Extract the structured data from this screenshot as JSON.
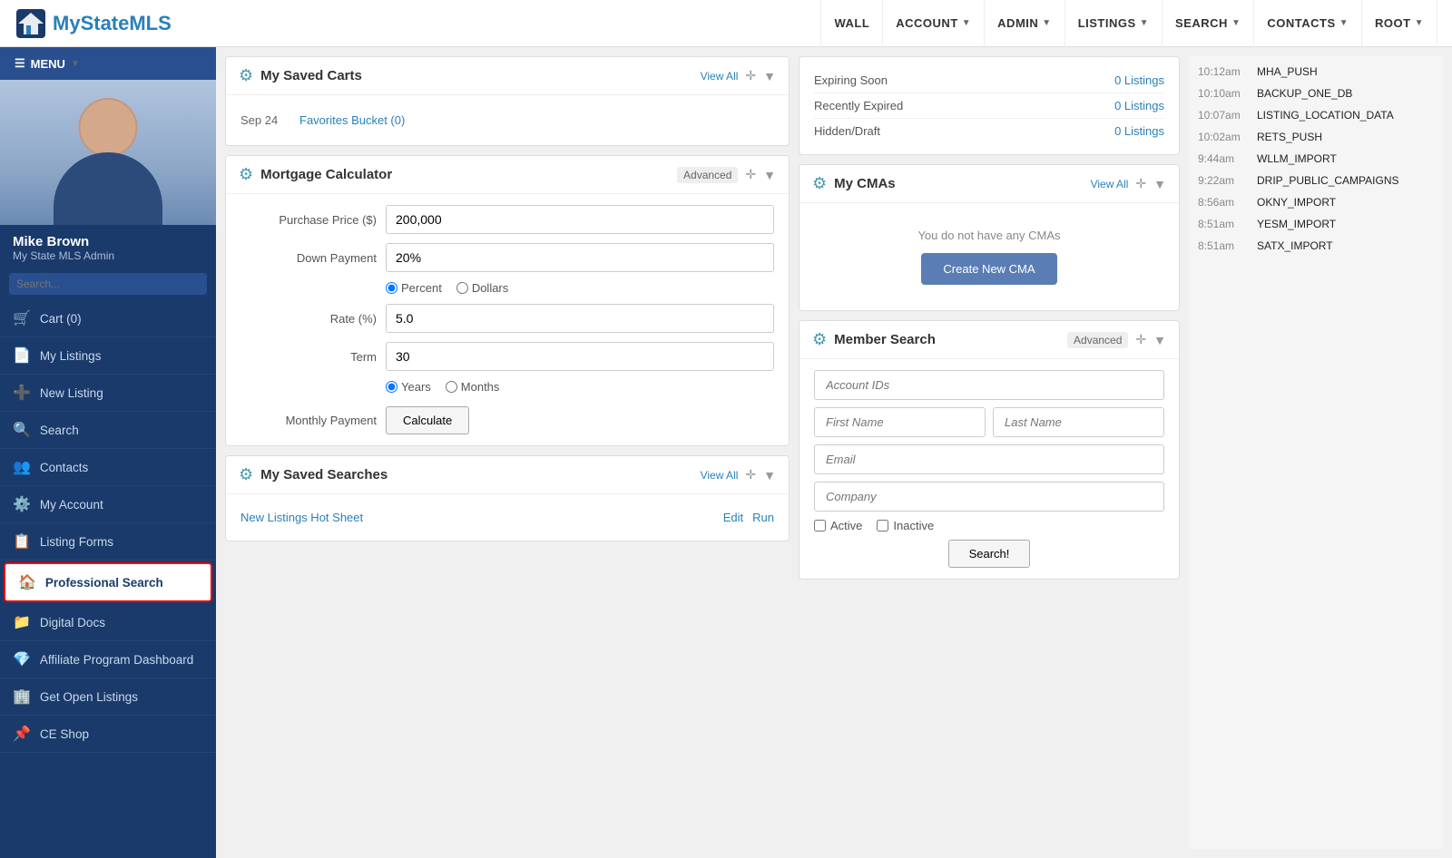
{
  "logo": {
    "text_my": "My",
    "text_state": "State",
    "text_mls": "MLS"
  },
  "topnav": {
    "wall": "WALL",
    "account": "ACCOUNT",
    "admin": "ADMIN",
    "listings": "LISTINGS",
    "search": "SEARCH",
    "contacts": "CONTACTS",
    "root": "ROOT"
  },
  "sidebar": {
    "menu_label": "MENU",
    "user_name": "Mike Brown",
    "user_role": "My State MLS Admin",
    "items": [
      {
        "id": "cart",
        "label": "Cart (0)",
        "icon": "🛒"
      },
      {
        "id": "my-listings",
        "label": "My Listings",
        "icon": "📄"
      },
      {
        "id": "new-listing",
        "label": "New Listing",
        "icon": "➕"
      },
      {
        "id": "search",
        "label": "Search",
        "icon": "🔍"
      },
      {
        "id": "contacts",
        "label": "Contacts",
        "icon": "👥"
      },
      {
        "id": "my-account",
        "label": "My Account",
        "icon": "⚙️"
      },
      {
        "id": "listing-forms",
        "label": "Listing Forms",
        "icon": "📋"
      },
      {
        "id": "professional-search",
        "label": "Professional Search",
        "icon": "🏠",
        "active": true
      },
      {
        "id": "digital-docs",
        "label": "Digital Docs",
        "icon": "📁"
      },
      {
        "id": "affiliate-program",
        "label": "Affiliate Program Dashboard",
        "icon": "💎"
      },
      {
        "id": "get-open-listings",
        "label": "Get Open Listings",
        "icon": "🏢"
      },
      {
        "id": "ce-shop",
        "label": "CE Shop",
        "icon": "📌"
      }
    ]
  },
  "saved_carts": {
    "title": "My Saved Carts",
    "view_all": "View All",
    "items": [
      {
        "date": "Sep 24",
        "name": "Favorites Bucket (0)"
      }
    ]
  },
  "mortgage_calculator": {
    "title": "Mortgage Calculator",
    "badge": "Advanced",
    "purchase_price_label": "Purchase Price ($)",
    "purchase_price_value": "200,000",
    "down_payment_label": "Down Payment",
    "down_payment_value": "20%",
    "radio_percent": "Percent",
    "radio_dollars": "Dollars",
    "rate_label": "Rate (%)",
    "rate_value": "5.0",
    "term_label": "Term",
    "term_value": "30",
    "radio_years": "Years",
    "radio_months": "Months",
    "monthly_payment_label": "Monthly Payment",
    "calculate_btn": "Calculate"
  },
  "saved_searches": {
    "title": "My Saved Searches",
    "view_all": "View All",
    "items": [
      {
        "name": "New Listings Hot Sheet",
        "edit": "Edit",
        "run": "Run"
      }
    ]
  },
  "listing_statuses": {
    "expiring_soon_label": "Expiring Soon",
    "expiring_soon_count": "0 Listings",
    "recently_expired_label": "Recently Expired",
    "recently_expired_count": "0 Listings",
    "hidden_draft_label": "Hidden/Draft",
    "hidden_draft_count": "0 Listings"
  },
  "my_cmas": {
    "title": "My CMAs",
    "view_all": "View All",
    "empty_message": "You do not have any CMAs",
    "create_btn": "Create New CMA"
  },
  "member_search": {
    "title": "Member Search",
    "badge": "Advanced",
    "account_ids_placeholder": "Account IDs",
    "first_name_placeholder": "First Name",
    "last_name_placeholder": "Last Name",
    "email_placeholder": "Email",
    "company_placeholder": "Company",
    "active_label": "Active",
    "inactive_label": "Inactive",
    "search_btn": "Search!"
  },
  "activity_log": [
    {
      "time": "10:12am",
      "label": "MHA_PUSH"
    },
    {
      "time": "10:10am",
      "label": "BACKUP_ONE_DB"
    },
    {
      "time": "10:07am",
      "label": "LISTING_LOCATION_DATA"
    },
    {
      "time": "10:02am",
      "label": "RETS_PUSH"
    },
    {
      "time": "9:44am",
      "label": "WLLM_IMPORT"
    },
    {
      "time": "9:22am",
      "label": "DRIP_PUBLIC_CAMPAIGNS"
    },
    {
      "time": "8:56am",
      "label": "OKNY_IMPORT"
    },
    {
      "time": "8:51am",
      "label": "YESM_IMPORT"
    },
    {
      "time": "8:51am",
      "label": "SATX_IMPORT"
    }
  ]
}
